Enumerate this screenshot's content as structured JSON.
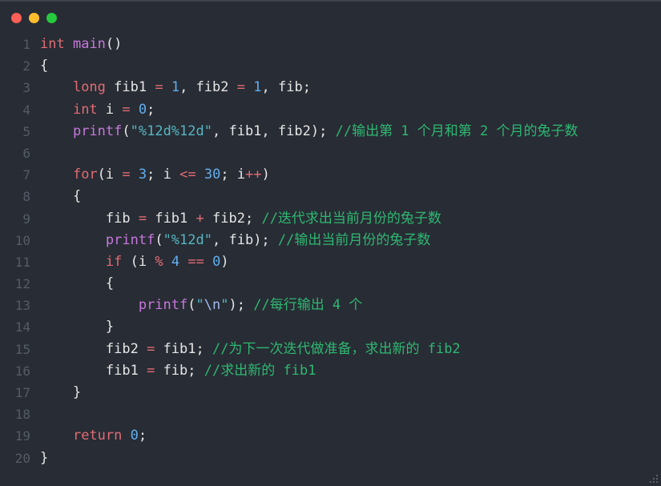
{
  "window": {
    "background_color": "#282c34",
    "titlebar": {
      "buttons": [
        {
          "name": "close",
          "label": "",
          "color": "#ff5f56"
        },
        {
          "name": "minimize",
          "label": "",
          "color": "#ffbd2e"
        },
        {
          "name": "maximize",
          "label": "",
          "color": "#27c93f"
        }
      ]
    }
  },
  "editor": {
    "language": "c",
    "line_number_color": "#545c66",
    "theme_colors": {
      "keyword": "#e06c75",
      "function": "#c678dd",
      "number": "#61afef",
      "string": "#56b6c2",
      "escape": "#a3b8ef",
      "operator": "#e06c75",
      "identifier": "#e6e6e6",
      "comment": "#2eb872"
    },
    "lines": [
      {
        "n": "1",
        "tokens": [
          {
            "t": "int",
            "c": "kw"
          },
          {
            "t": " ",
            "c": "id"
          },
          {
            "t": "main",
            "c": "fn"
          },
          {
            "t": "()",
            "c": "punc"
          }
        ]
      },
      {
        "n": "2",
        "tokens": [
          {
            "t": "{",
            "c": "punc"
          }
        ]
      },
      {
        "n": "3",
        "tokens": [
          {
            "t": "    ",
            "c": "id"
          },
          {
            "t": "long",
            "c": "kw"
          },
          {
            "t": " fib1 ",
            "c": "id"
          },
          {
            "t": "=",
            "c": "op"
          },
          {
            "t": " ",
            "c": "id"
          },
          {
            "t": "1",
            "c": "num"
          },
          {
            "t": ", ",
            "c": "punc"
          },
          {
            "t": "fib2 ",
            "c": "id"
          },
          {
            "t": "=",
            "c": "op"
          },
          {
            "t": " ",
            "c": "id"
          },
          {
            "t": "1",
            "c": "num"
          },
          {
            "t": ", ",
            "c": "punc"
          },
          {
            "t": "fib",
            "c": "id"
          },
          {
            "t": ";",
            "c": "punc"
          }
        ]
      },
      {
        "n": "4",
        "tokens": [
          {
            "t": "    ",
            "c": "id"
          },
          {
            "t": "int",
            "c": "kw"
          },
          {
            "t": " i ",
            "c": "id"
          },
          {
            "t": "=",
            "c": "op"
          },
          {
            "t": " ",
            "c": "id"
          },
          {
            "t": "0",
            "c": "num"
          },
          {
            "t": ";",
            "c": "punc"
          }
        ]
      },
      {
        "n": "5",
        "tokens": [
          {
            "t": "    ",
            "c": "id"
          },
          {
            "t": "printf",
            "c": "fn"
          },
          {
            "t": "(",
            "c": "punc"
          },
          {
            "t": "\"%12d%12d\"",
            "c": "str"
          },
          {
            "t": ", ",
            "c": "punc"
          },
          {
            "t": "fib1",
            "c": "id"
          },
          {
            "t": ", ",
            "c": "punc"
          },
          {
            "t": "fib2",
            "c": "id"
          },
          {
            "t": ");",
            "c": "punc"
          },
          {
            "t": " ",
            "c": "id"
          },
          {
            "t": "//输出第 1 个月和第 2 个月的兔子数",
            "c": "cmt"
          }
        ]
      },
      {
        "n": "6",
        "tokens": []
      },
      {
        "n": "7",
        "tokens": [
          {
            "t": "    ",
            "c": "id"
          },
          {
            "t": "for",
            "c": "kw"
          },
          {
            "t": "(",
            "c": "punc"
          },
          {
            "t": "i ",
            "c": "id"
          },
          {
            "t": "=",
            "c": "op"
          },
          {
            "t": " ",
            "c": "id"
          },
          {
            "t": "3",
            "c": "num"
          },
          {
            "t": "; ",
            "c": "punc"
          },
          {
            "t": "i ",
            "c": "id"
          },
          {
            "t": "<=",
            "c": "op"
          },
          {
            "t": " ",
            "c": "id"
          },
          {
            "t": "30",
            "c": "num"
          },
          {
            "t": "; ",
            "c": "punc"
          },
          {
            "t": "i",
            "c": "id"
          },
          {
            "t": "++",
            "c": "op"
          },
          {
            "t": ")",
            "c": "punc"
          }
        ]
      },
      {
        "n": "8",
        "tokens": [
          {
            "t": "    ",
            "c": "id"
          },
          {
            "t": "{",
            "c": "punc"
          }
        ]
      },
      {
        "n": "9",
        "tokens": [
          {
            "t": "        ",
            "c": "id"
          },
          {
            "t": "fib ",
            "c": "id"
          },
          {
            "t": "=",
            "c": "op"
          },
          {
            "t": " fib1 ",
            "c": "id"
          },
          {
            "t": "+",
            "c": "op"
          },
          {
            "t": " fib2",
            "c": "id"
          },
          {
            "t": ";",
            "c": "punc"
          },
          {
            "t": " ",
            "c": "id"
          },
          {
            "t": "//迭代求出当前月份的兔子数",
            "c": "cmt"
          }
        ]
      },
      {
        "n": "10",
        "tokens": [
          {
            "t": "        ",
            "c": "id"
          },
          {
            "t": "printf",
            "c": "fn"
          },
          {
            "t": "(",
            "c": "punc"
          },
          {
            "t": "\"%12d\"",
            "c": "str"
          },
          {
            "t": ", ",
            "c": "punc"
          },
          {
            "t": "fib",
            "c": "id"
          },
          {
            "t": ");",
            "c": "punc"
          },
          {
            "t": " ",
            "c": "id"
          },
          {
            "t": "//输出当前月份的兔子数",
            "c": "cmt"
          }
        ]
      },
      {
        "n": "11",
        "tokens": [
          {
            "t": "        ",
            "c": "id"
          },
          {
            "t": "if",
            "c": "kw"
          },
          {
            "t": " (",
            "c": "punc"
          },
          {
            "t": "i ",
            "c": "id"
          },
          {
            "t": "%",
            "c": "op"
          },
          {
            "t": " ",
            "c": "id"
          },
          {
            "t": "4",
            "c": "num"
          },
          {
            "t": " ",
            "c": "id"
          },
          {
            "t": "==",
            "c": "op"
          },
          {
            "t": " ",
            "c": "id"
          },
          {
            "t": "0",
            "c": "num"
          },
          {
            "t": ")",
            "c": "punc"
          }
        ]
      },
      {
        "n": "12",
        "tokens": [
          {
            "t": "        ",
            "c": "id"
          },
          {
            "t": "{",
            "c": "punc"
          }
        ]
      },
      {
        "n": "13",
        "tokens": [
          {
            "t": "            ",
            "c": "id"
          },
          {
            "t": "printf",
            "c": "fn"
          },
          {
            "t": "(",
            "c": "punc"
          },
          {
            "t": "\"",
            "c": "str"
          },
          {
            "t": "\\n",
            "c": "esc"
          },
          {
            "t": "\"",
            "c": "str"
          },
          {
            "t": ");",
            "c": "punc"
          },
          {
            "t": " ",
            "c": "id"
          },
          {
            "t": "//每行输出 4 个",
            "c": "cmt"
          }
        ]
      },
      {
        "n": "14",
        "tokens": [
          {
            "t": "        ",
            "c": "id"
          },
          {
            "t": "}",
            "c": "punc"
          }
        ]
      },
      {
        "n": "15",
        "tokens": [
          {
            "t": "        ",
            "c": "id"
          },
          {
            "t": "fib2 ",
            "c": "id"
          },
          {
            "t": "=",
            "c": "op"
          },
          {
            "t": " fib1",
            "c": "id"
          },
          {
            "t": ";",
            "c": "punc"
          },
          {
            "t": " ",
            "c": "id"
          },
          {
            "t": "//为下一次迭代做准备，求出新的 fib2",
            "c": "cmt"
          }
        ]
      },
      {
        "n": "16",
        "tokens": [
          {
            "t": "        ",
            "c": "id"
          },
          {
            "t": "fib1 ",
            "c": "id"
          },
          {
            "t": "=",
            "c": "op"
          },
          {
            "t": " fib",
            "c": "id"
          },
          {
            "t": ";",
            "c": "punc"
          },
          {
            "t": " ",
            "c": "id"
          },
          {
            "t": "//求出新的 fib1",
            "c": "cmt"
          }
        ]
      },
      {
        "n": "17",
        "tokens": [
          {
            "t": "    ",
            "c": "id"
          },
          {
            "t": "}",
            "c": "punc"
          }
        ]
      },
      {
        "n": "18",
        "tokens": []
      },
      {
        "n": "19",
        "tokens": [
          {
            "t": "    ",
            "c": "id"
          },
          {
            "t": "return",
            "c": "kw"
          },
          {
            "t": " ",
            "c": "id"
          },
          {
            "t": "0",
            "c": "num"
          },
          {
            "t": ";",
            "c": "punc"
          }
        ]
      },
      {
        "n": "20",
        "tokens": [
          {
            "t": "}",
            "c": "punc"
          }
        ]
      }
    ]
  }
}
